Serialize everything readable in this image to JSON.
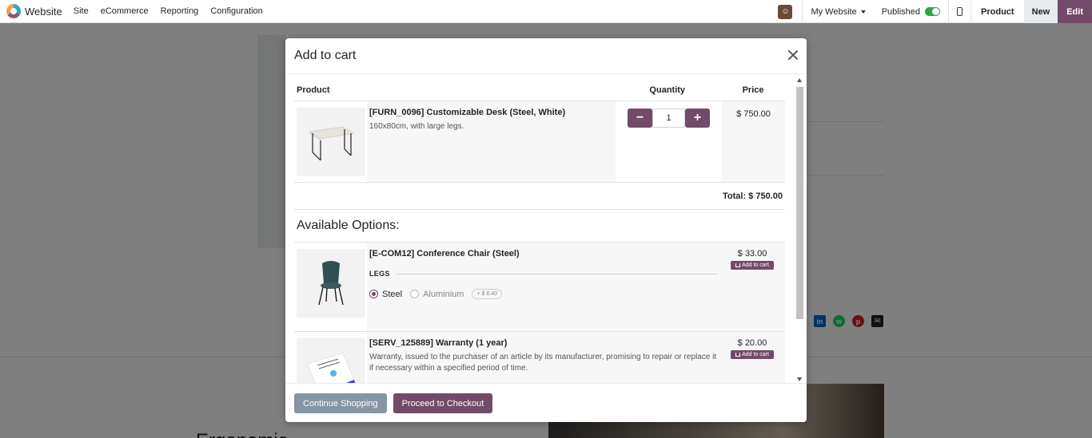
{
  "topbar": {
    "brand": "Website",
    "menu": [
      "Site",
      "eCommerce",
      "Reporting",
      "Configuration"
    ],
    "website_selector": "My Website",
    "published_label": "Published",
    "product_label": "Product",
    "new_label": "New",
    "edit_label": "Edit"
  },
  "background": {
    "heading": "Ergonomic",
    "share_icons": [
      "linkedin-icon",
      "whatsapp-icon",
      "pinterest-icon",
      "email-icon"
    ]
  },
  "modal": {
    "title": "Add to cart",
    "columns": {
      "product": "Product",
      "quantity": "Quantity",
      "price": "Price"
    },
    "main_product": {
      "name": "[FURN_0096] Customizable Desk (Steel, White)",
      "description": "160x80cm, with large legs.",
      "quantity": "1",
      "price": "$ 750.00",
      "decrement": "−",
      "increment": "+"
    },
    "total": "Total: $ 750.00",
    "available_options_title": "Available Options:",
    "options": [
      {
        "name": "[E-COM12] Conference Chair (Steel)",
        "price": "$ 33.00",
        "add_label": "Add to cart",
        "attribute_label": "LEGS",
        "values": [
          {
            "label": "Steel",
            "selected": true
          },
          {
            "label": "Aluminium",
            "selected": false,
            "extra": "+ $ 6.40"
          }
        ]
      },
      {
        "name": "[SERV_125889] Warranty (1 year)",
        "price": "$ 20.00",
        "add_label": "Add to cart",
        "description": "Warranty, issued to the purchaser of an article by its manufacturer, promising to repair or replace it if necessary within a specified period of time."
      }
    ],
    "footer": {
      "continue_label": "Continue Shopping",
      "checkout_label": "Proceed to Checkout"
    }
  },
  "colors": {
    "primary": "#714b67",
    "secondary": "#8595a2",
    "toggle_on": "#28a745"
  }
}
